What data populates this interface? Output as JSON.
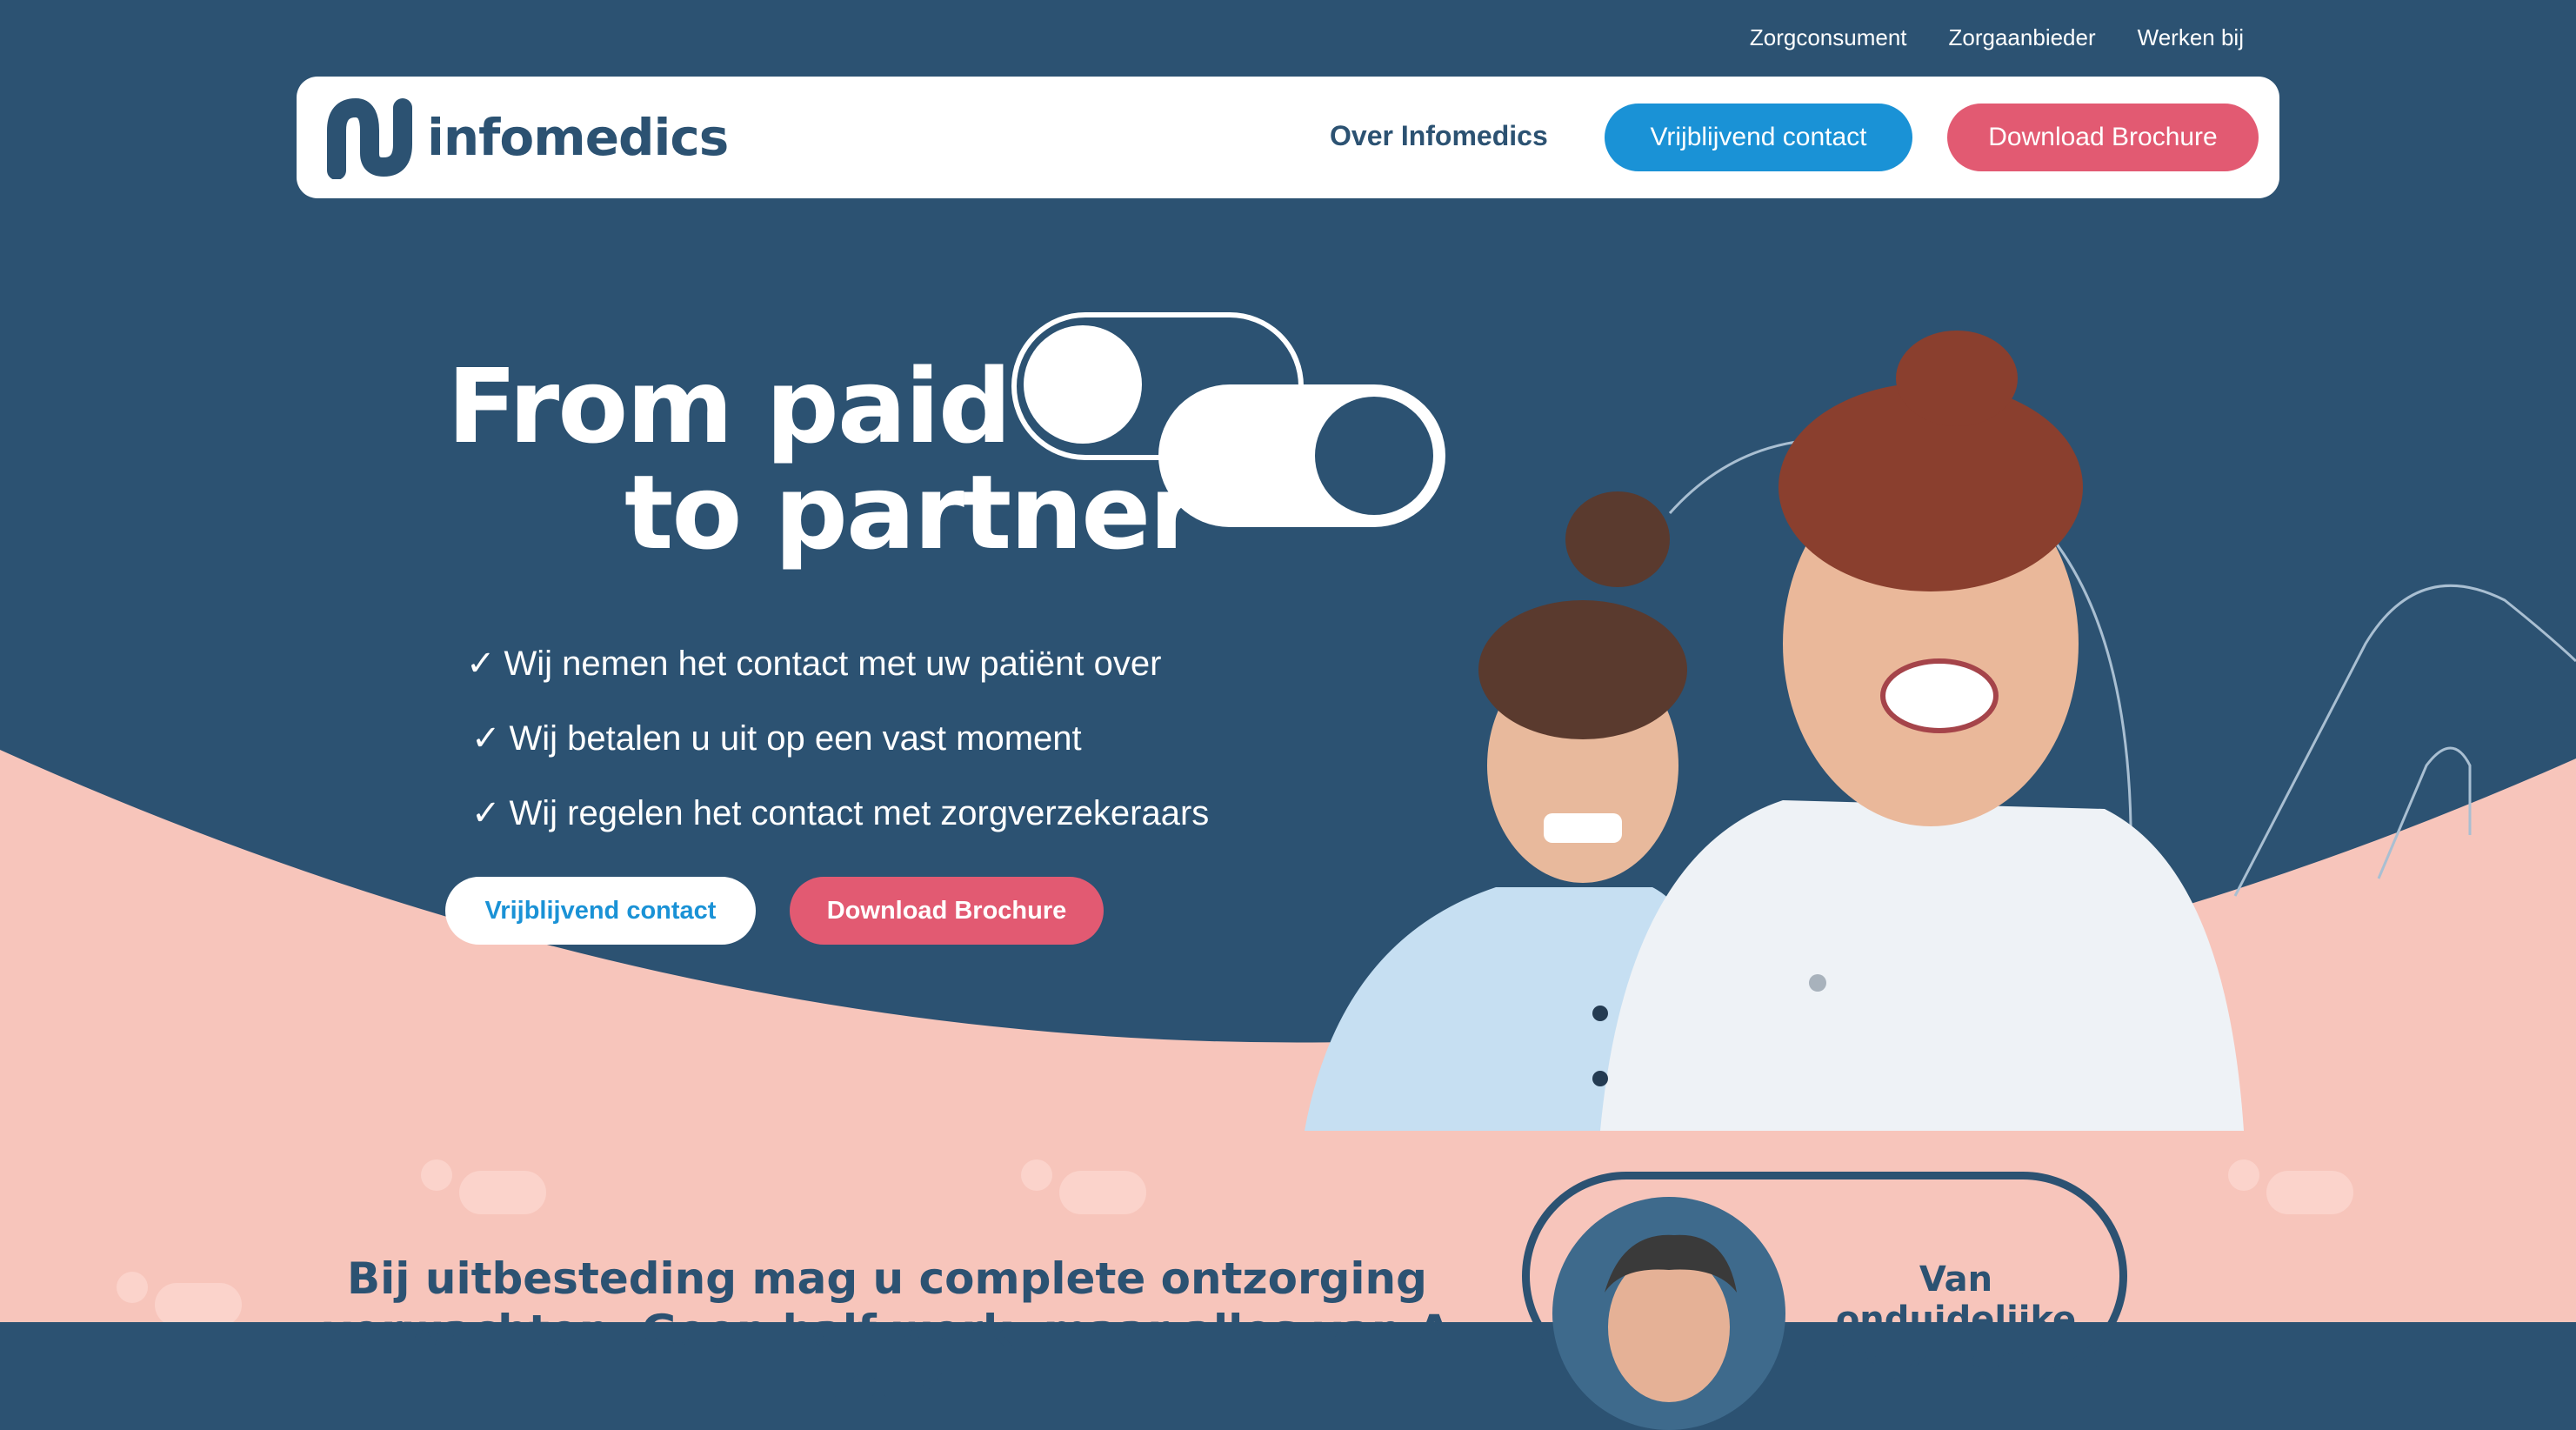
{
  "topnav": {
    "items": [
      "Zorgconsument",
      "Zorgaanbieder",
      "Werken bij"
    ]
  },
  "header": {
    "logo_text": "infomedics",
    "nav_link": "Over Infomedics",
    "contact_button": "Vrijblijvend contact",
    "brochure_button": "Download Brochure"
  },
  "hero": {
    "title_line1": "From paid",
    "title_line2": "to partner",
    "check_glyph": "✓",
    "bullets": [
      "Wij nemen het contact met uw patiënt over",
      "Wij betalen u uit op een vast moment",
      "Wij regelen het contact met zorgverzekeraars"
    ],
    "contact_button": "Vrijblijvend contact",
    "brochure_button": "Download Brochure"
  },
  "section": {
    "heading": "Bij uitbesteding mag u complete ontzorging verwachten. Geen half werk, maar alles van A tot Z",
    "card_text": "Van onduidelijke afwijzingen op"
  },
  "colors": {
    "navy": "#2c5272",
    "pink_bg": "#f7c5bb",
    "accent_blue": "#1a92d6",
    "accent_pink": "#e25a72",
    "white": "#ffffff"
  },
  "icons": [
    "infomedics-logo-icon",
    "toggle-switch-icon",
    "check-icon"
  ]
}
